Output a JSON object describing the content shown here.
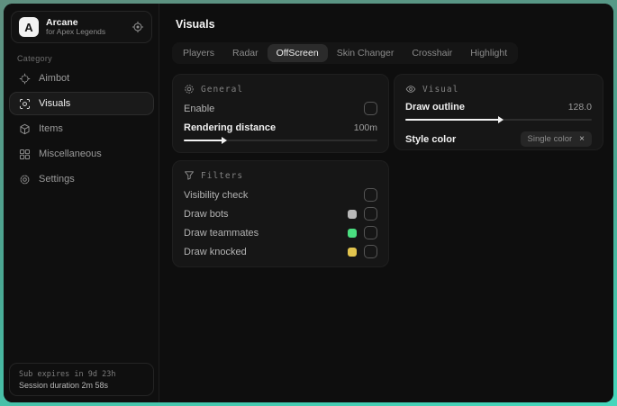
{
  "app": {
    "logo_letter": "A",
    "name": "Arcane",
    "subtitle": "for Apex Legends",
    "logo_icon": "target-icon"
  },
  "colors": {
    "frame_gradient_start": "#5f8f7f",
    "frame_gradient_end": "#45d7bc",
    "window_bg": "#0e0e0e",
    "card_bg": "#161616"
  },
  "sidebar": {
    "category_label": "Category",
    "items": [
      {
        "label": "Aimbot",
        "icon": "crosshair-icon",
        "selected": false
      },
      {
        "label": "Visuals",
        "icon": "scan-eye-icon",
        "selected": true
      },
      {
        "label": "Items",
        "icon": "cube-icon",
        "selected": false
      },
      {
        "label": "Miscellaneous",
        "icon": "grid-icon",
        "selected": false
      },
      {
        "label": "Settings",
        "icon": "gear-icon",
        "selected": false
      }
    ],
    "status": {
      "sub_expires": "Sub expires in 9d 23h",
      "session_duration": "Session duration 2m 58s"
    }
  },
  "main": {
    "title": "Visuals",
    "tabs": [
      {
        "label": "Players",
        "selected": false
      },
      {
        "label": "Radar",
        "selected": false
      },
      {
        "label": "OffScreen",
        "selected": true
      },
      {
        "label": "Skin Changer",
        "selected": false
      },
      {
        "label": "Crosshair",
        "selected": false
      },
      {
        "label": "Highlight",
        "selected": false
      }
    ],
    "general": {
      "title": "General",
      "icon": "sun-icon",
      "enable_label": "Enable",
      "enable_checked": false,
      "rendering_distance_label": "Rendering distance",
      "rendering_distance_value": "100m",
      "slider_percent": 20
    },
    "visual": {
      "title": "Visual",
      "icon": "eye-icon",
      "draw_outline_label": "Draw outline",
      "draw_outline_value": "128.0",
      "slider_percent": 50,
      "style_color_label": "Style color",
      "style_color_value": "Single color",
      "clear_symbol": "×"
    },
    "filters": {
      "title": "Filters",
      "icon": "funnel-icon",
      "rows": [
        {
          "label": "Visibility check",
          "checked": false
        },
        {
          "label": "Draw bots",
          "swatch": "#b8b8b8",
          "checked": false
        },
        {
          "label": "Draw teammates",
          "swatch": "#4ade80",
          "checked": false
        },
        {
          "label": "Draw knocked",
          "swatch": "#e2c44e",
          "checked": false
        }
      ]
    }
  }
}
